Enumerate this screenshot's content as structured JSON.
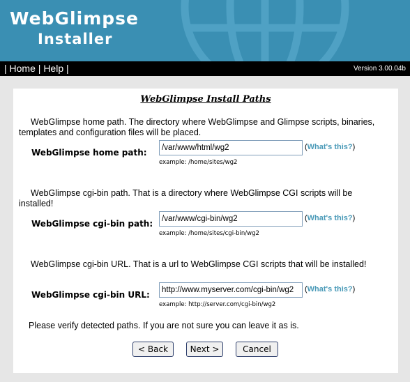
{
  "header": {
    "logo_line1": "WebGlimpse",
    "logo_line2": "Installer",
    "globe_icon": "globe-icon",
    "colors": {
      "background": "#3a8fb3",
      "globe": "#4f9fc2"
    }
  },
  "nav": {
    "sep": "|",
    "home": "Home",
    "help": "Help",
    "version": "Version 3.00.04b"
  },
  "page": {
    "title": "WebGlimpse Install Paths",
    "fields": [
      {
        "description": "WebGlimpse home path. The directory where WebGlimpse and Glimpse scripts, binaries, templates and configuration files will be placed.",
        "label": "WebGlimpse home path:",
        "value": "/var/www/html/wg2",
        "help_open": "(",
        "help_link": "What's this?",
        "help_close": ")",
        "example": "example: /home/sites/wg2"
      },
      {
        "description": "WebGlimpse cgi-bin path. That is a directory where WebGlimpse CGI scripts will be installed!",
        "label": "WebGlimpse cgi-bin path:",
        "value": "/var/www/cgi-bin/wg2",
        "help_open": "(",
        "help_link": "What's this?",
        "help_close": ")",
        "example": "example: /home/sites/cgi-bin/wg2"
      },
      {
        "description": "WebGlimpse cgi-bin URL. That is a url to WebGlimpse CGI scripts that will be installed!",
        "label": "WebGlimpse cgi-bin URL:",
        "value": "http://www.myserver.com/cgi-bin/wg2",
        "help_open": "(",
        "help_link": "What's this?",
        "help_close": ")",
        "example": "example: http://server.com/cgi-bin/wg2"
      }
    ],
    "verify_text": "Please verify detected paths. If you are not sure you can leave it as is.",
    "buttons": {
      "back": "< Back",
      "next": "Next >",
      "cancel": "Cancel"
    }
  }
}
